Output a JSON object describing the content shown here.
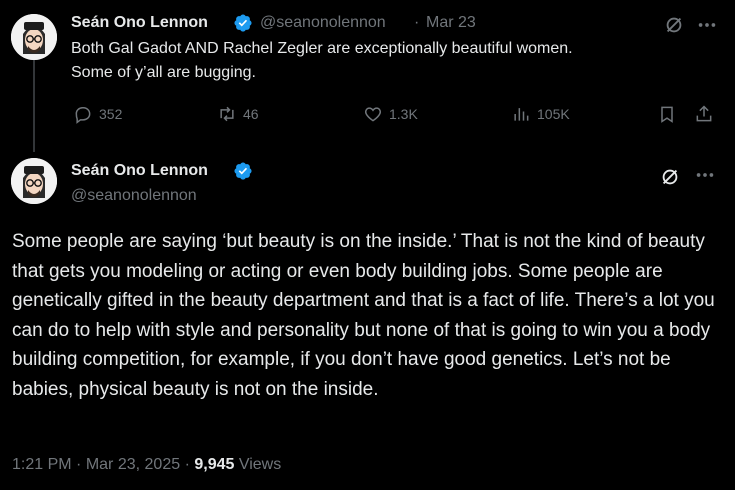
{
  "tweet1": {
    "display_name": "Seán Ono Lennon",
    "handle": "@seanonolennon",
    "separator": "·",
    "date": "Mar 23",
    "text_line1": "Both Gal Gadot AND Rachel Zegler are exceptionally beautiful women.",
    "text_line2": "Some of y’all are bugging.",
    "replies": "352",
    "retweets": "46",
    "likes": "1.3K",
    "views": "105K"
  },
  "tweet2": {
    "display_name": "Seán Ono Lennon",
    "handle": "@seanonolennon",
    "body": "Some people are saying ‘but beauty is on the inside.’ That is not the kind of beauty that gets you modeling or acting or even body building jobs. Some people are genetically gifted in the beauty department and that is a fact of life. There’s a lot you can do to help with style and personality but none of that is going to win you a body building competition, for example, if you don’t have good genetics. Let’s not be babies, physical beauty is not on the inside.",
    "time": "1:21 PM",
    "sep1": "·",
    "date": "Mar 23, 2025",
    "sep2": "·",
    "views_count": "9,945",
    "views_label": "Views"
  },
  "colors": {
    "background": "#000000",
    "text": "#e7e9ea",
    "muted": "#71767b",
    "verified": "#1d9bf0"
  }
}
